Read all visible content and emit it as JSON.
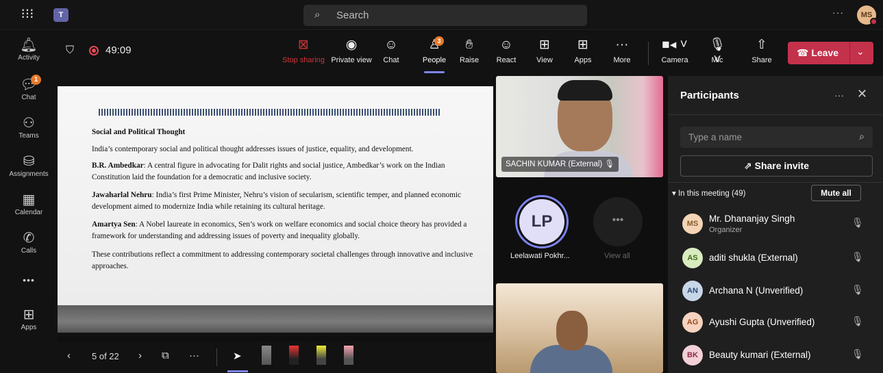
{
  "topbar": {
    "search_placeholder": "Search",
    "more": "···",
    "user_initials": "MS"
  },
  "rail": [
    {
      "icon": "bell-icon",
      "label": "Activity"
    },
    {
      "icon": "chat-icon",
      "label": "Chat",
      "badge": "1"
    },
    {
      "icon": "teams-icon",
      "label": "Teams"
    },
    {
      "icon": "backpack-icon",
      "label": "Assignments"
    },
    {
      "icon": "calendar-icon",
      "label": "Calendar"
    },
    {
      "icon": "phone-icon",
      "label": "Calls"
    },
    {
      "icon": "more-icon",
      "label": "•••"
    },
    {
      "icon": "plus-icon",
      "label": "Apps"
    }
  ],
  "meeting": {
    "timer": "49:09",
    "toolbar": {
      "stop_sharing": "Stop sharing",
      "private_view": "Private view",
      "chat": "Chat",
      "people": "People",
      "people_badge": "3",
      "raise": "Raise",
      "react": "React",
      "view": "View",
      "apps": "Apps",
      "more": "More",
      "camera": "Camera",
      "mic": "Mic",
      "share": "Share",
      "leave": "Leave"
    }
  },
  "slide": {
    "heading": "Social and Political Thought",
    "intro": "India’s contemporary social and political thought addresses issues of justice, equality, and development.",
    "ambedkar_name": "B.R. Ambedkar",
    "ambedkar_text": ": A central figure in advocating for Dalit rights and social justice, Ambedkar’s work on the Indian Constitution laid the foundation for a democratic and inclusive society.",
    "nehru_name": "Jawaharlal Nehru",
    "nehru_text": ": India’s first Prime Minister, Nehru’s vision of secularism, scientific temper, and planned economic development aimed to modernize India while retaining its cultural heritage.",
    "sen_name": "Amartya Sen",
    "sen_text": ": A Nobel laureate in economics, Sen’s work on welfare economics and social choice theory has provided a framework for understanding and addressing issues of poverty and inequality globally.",
    "conclusion": "These contributions reflect a commitment to addressing contemporary societal challenges through innovative and inclusive approaches."
  },
  "slide_controls": {
    "page": "5 of 22",
    "more": "···"
  },
  "video": {
    "tile1_name": "SACHIN KUMAR (External)",
    "lp_initials": "LP",
    "lp_name": "Leelawati Pokhr...",
    "more_dots": "•••",
    "view_all": "View all"
  },
  "participants": {
    "title": "Participants",
    "more": "···",
    "search_placeholder": "Type a name",
    "share_invite": "Share invite",
    "in_meeting": "In this meeting (49)",
    "mute_all": "Mute all",
    "list": [
      {
        "initials": "MS",
        "name": "Mr. Dhananjay Singh",
        "role": "Organizer",
        "color": "#f3d5b5",
        "text": "#8a5a2b"
      },
      {
        "initials": "AS",
        "name": "aditi shukla (External)",
        "role": "",
        "color": "#d8ecc0",
        "text": "#3e6b1a"
      },
      {
        "initials": "AN",
        "name": "Archana N (Unverified)",
        "role": "",
        "color": "#c8d6e8",
        "text": "#2d4a6e"
      },
      {
        "initials": "AG",
        "name": "Ayushi Gupta (Unverified)",
        "role": "",
        "color": "#f6d3c0",
        "text": "#9a4a1d"
      },
      {
        "initials": "BK",
        "name": "Beauty kumari (External)",
        "role": "",
        "color": "#f4d0d8",
        "text": "#8e2b46"
      }
    ]
  }
}
